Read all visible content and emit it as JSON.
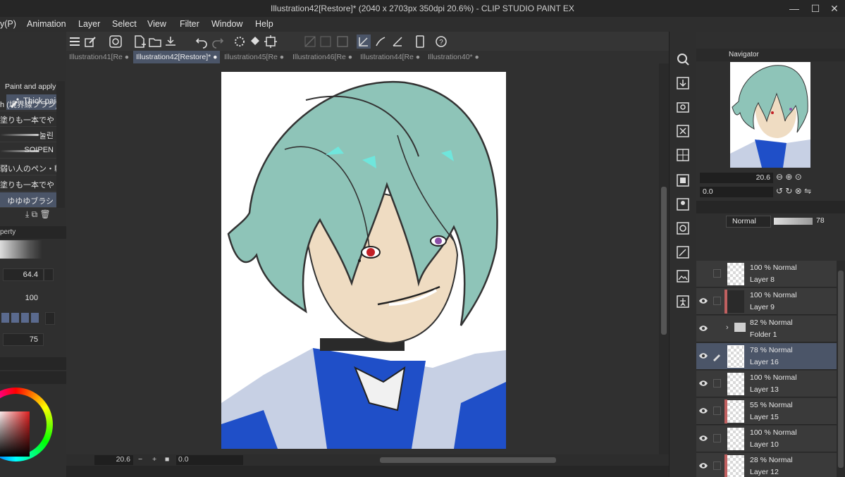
{
  "window": {
    "title": "Illustration42[Restore]* (2040 x 2703px 350dpi 20.6%)  - CLIP STUDIO PAINT EX",
    "minimize": "—",
    "maximize": "☐",
    "close": "✕"
  },
  "menu": [
    "y(P)",
    "Animation",
    "Layer",
    "Select",
    "View",
    "Filter",
    "Window",
    "Help"
  ],
  "tabs": [
    {
      "label": "Illustration41[Rе",
      "active": false
    },
    {
      "label": "Illustration42[Restore]*",
      "active": true
    },
    {
      "label": "Illustration45[Rе",
      "active": false
    },
    {
      "label": "Illustration46[Rе",
      "active": false
    },
    {
      "label": "Illustration44[Rе",
      "active": false
    },
    {
      "label": "Illustration40*",
      "active": false
    }
  ],
  "left_panel": {
    "brush_tab": "Thick paint",
    "paint_apply": "Paint and apply",
    "brushes": [
      "h (境界線ブラシ)",
      "塗りも一本でや",
      "눌린",
      "SOIPEN",
      "弱い人のペン・軟",
      "塗りも一本でや",
      "ゆゆゆブラシ"
    ],
    "property_tab": "perty",
    "brush_size": "64.4",
    "opacity": "100",
    "blend_value": "75"
  },
  "statusbar": {
    "zoom": "20.6",
    "rotation": "0.0"
  },
  "navigator": {
    "tab": "Navigator",
    "zoom": "20.6",
    "rotation": "0.0"
  },
  "layer_panel": {
    "blend_mode": "Normal",
    "opacity": "78"
  },
  "layers": [
    {
      "opacity_mode": "100 % Normal",
      "name": "Layer 8",
      "visible": false,
      "color": "none",
      "selected": false
    },
    {
      "opacity_mode": "100 % Normal",
      "name": "Layer 9",
      "visible": true,
      "color": "#c86868",
      "selected": false
    },
    {
      "opacity_mode": "82 % Normal",
      "name": "Folder 1",
      "visible": true,
      "color": "none",
      "selected": false,
      "folder": true
    },
    {
      "opacity_mode": "78 % Normal",
      "name": "Layer 16",
      "visible": true,
      "color": "none",
      "selected": true
    },
    {
      "opacity_mode": "100 % Normal",
      "name": "Layer 13",
      "visible": true,
      "color": "none",
      "selected": false
    },
    {
      "opacity_mode": "55 % Normal",
      "name": "Layer 15",
      "visible": true,
      "color": "#c86868",
      "selected": false
    },
    {
      "opacity_mode": "100 % Normal",
      "name": "Layer 10",
      "visible": true,
      "color": "none",
      "selected": false
    },
    {
      "opacity_mode": "28 % Normal",
      "name": "Layer 12",
      "visible": true,
      "color": "#c86868",
      "selected": false
    }
  ],
  "colors": {
    "accent": "#4b5568",
    "hair": "#8ec4b8",
    "outfit_blue": "#1f4fc8"
  }
}
